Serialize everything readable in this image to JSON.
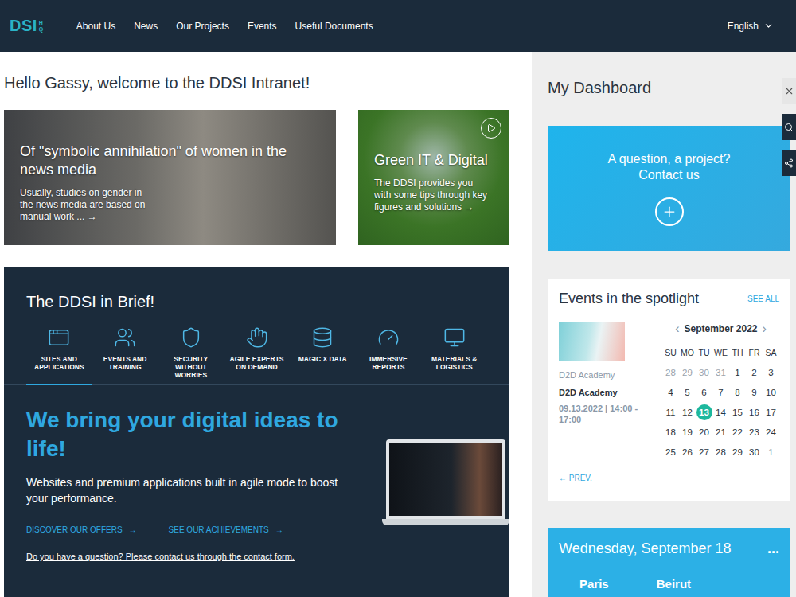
{
  "nav": {
    "logo": "DSI",
    "logo_suffix": "HQ",
    "items": [
      "About Us",
      "News",
      "Our Projects",
      "Events",
      "Useful Documents"
    ],
    "language": "English"
  },
  "greeting": "Hello Gassy, welcome to the DDSI Intranet!",
  "featured": [
    {
      "kind": "article",
      "title": "Of \"symbolic annihilation\" of women in the news media",
      "summary": "Usually, studies on gender in the news media are based on manual work ...",
      "arrow": "→"
    },
    {
      "kind": "video",
      "title": "Green IT & Digital",
      "summary": "The DDSI provides you with some tips through key figures and solutions",
      "arrow": "→"
    }
  ],
  "brief": {
    "title": "The DDSI in Brief!",
    "tabs": [
      {
        "label": "SITES AND APPLICATIONS",
        "selected": true
      },
      {
        "label": "EVENTS AND TRAINING",
        "selected": false
      },
      {
        "label": "SECURITY WITHOUT WORRIES",
        "selected": false
      },
      {
        "label": "AGILE EXPERTS ON DEMAND",
        "selected": false
      },
      {
        "label": "MAGIC X DATA",
        "selected": false
      },
      {
        "label": "IMMERSIVE REPORTS",
        "selected": false
      },
      {
        "label": "MATERIALS & LOGISTICS",
        "selected": false
      }
    ],
    "heading": "We bring your digital ideas to life!",
    "text": "Websites and premium applications built in agile mode to boost your performance.",
    "links": [
      {
        "label": "DISCOVER OUR OFFERS",
        "arrow": "→"
      },
      {
        "label": "SEE OUR ACHIEVEMENTS",
        "arrow": "→"
      }
    ],
    "contact_link": "Do you have a question? Please contact us through the contact form."
  },
  "dashboard": {
    "title": "My Dashboard",
    "contact": [
      "A question, a project?",
      "Contact us"
    ],
    "events": {
      "title": "Events in the spotlight",
      "see_all": "SEE ALL",
      "event": {
        "category": "D2D Academy",
        "name": "D2D Academy",
        "date": "09.13.2022 | 14:00 - 17:00"
      },
      "prev": "← PREV.",
      "calendar": {
        "month": "September 2022",
        "prev": "‹",
        "next": "›",
        "weekdays": [
          "SU",
          "MO",
          "TU",
          "WE",
          "TH",
          "FR",
          "SA"
        ],
        "days": [
          {
            "label": "28",
            "muted": true,
            "selected": false
          },
          {
            "label": "29",
            "muted": true,
            "selected": false
          },
          {
            "label": "30",
            "muted": true,
            "selected": false
          },
          {
            "label": "31",
            "muted": true,
            "selected": false
          },
          {
            "label": "1",
            "muted": false,
            "selected": false
          },
          {
            "label": "2",
            "muted": false,
            "selected": false
          },
          {
            "label": "3",
            "muted": false,
            "selected": false
          },
          {
            "label": "4",
            "muted": false,
            "selected": false
          },
          {
            "label": "5",
            "muted": false,
            "selected": false
          },
          {
            "label": "6",
            "muted": false,
            "selected": false
          },
          {
            "label": "7",
            "muted": false,
            "selected": false
          },
          {
            "label": "8",
            "muted": false,
            "selected": false
          },
          {
            "label": "9",
            "muted": false,
            "selected": false
          },
          {
            "label": "10",
            "muted": false,
            "selected": false
          },
          {
            "label": "11",
            "muted": false,
            "selected": false
          },
          {
            "label": "12",
            "muted": false,
            "selected": false
          },
          {
            "label": "13",
            "muted": false,
            "selected": true
          },
          {
            "label": "14",
            "muted": false,
            "selected": false
          },
          {
            "label": "15",
            "muted": false,
            "selected": false
          },
          {
            "label": "16",
            "muted": false,
            "selected": false
          },
          {
            "label": "17",
            "muted": false,
            "selected": false
          },
          {
            "label": "18",
            "muted": false,
            "selected": false
          },
          {
            "label": "19",
            "muted": false,
            "selected": false
          },
          {
            "label": "20",
            "muted": false,
            "selected": false
          },
          {
            "label": "21",
            "muted": false,
            "selected": false
          },
          {
            "label": "22",
            "muted": false,
            "selected": false
          },
          {
            "label": "23",
            "muted": false,
            "selected": false
          },
          {
            "label": "24",
            "muted": false,
            "selected": false
          },
          {
            "label": "25",
            "muted": false,
            "selected": false
          },
          {
            "label": "26",
            "muted": false,
            "selected": false
          },
          {
            "label": "27",
            "muted": false,
            "selected": false
          },
          {
            "label": "28",
            "muted": false,
            "selected": false
          },
          {
            "label": "29",
            "muted": false,
            "selected": false
          },
          {
            "label": "30",
            "muted": false,
            "selected": false
          },
          {
            "label": "1",
            "muted": true,
            "selected": false
          }
        ]
      }
    },
    "weather": {
      "date": "Wednesday, September 18",
      "menu": "...",
      "cities": [
        "Paris",
        "Beirut"
      ]
    }
  }
}
